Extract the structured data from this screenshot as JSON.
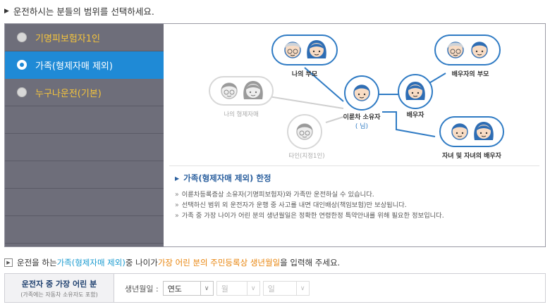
{
  "heading": "운전하시는 분들의 범위를 선택하세요.",
  "options": [
    {
      "label": "기명피보험자1인",
      "selected": false
    },
    {
      "label": "가족(형제자매 제외)",
      "selected": true
    },
    {
      "label": "누구나운전(기본)",
      "selected": false
    }
  ],
  "diagram": {
    "parents": "나의 부모",
    "spouse_parents": "배우자의 부모",
    "siblings": "나의 형제자매",
    "owner_line1": "이륜차 소유자",
    "owner_line2": "(              님)",
    "spouse": "배우자",
    "children": "자녀 및 자녀의 배우자",
    "other": "타인(지정1인)"
  },
  "info": {
    "title": "가족(형제자매 제외) 한정",
    "lines": [
      "이륜차등록증상 소유자(기명피보험자)와 가족만 운전하실 수 있습니다.",
      "선택하신 범위 외 운전자가 운행 중 사고를 내면 대인배상(책임보험)만 보상됩니다.",
      "가족 중 가장 나이가 어린 분의 생년월일은 정확한 연령한정 특약안내를 위해 필요한 정보입니다."
    ]
  },
  "question": {
    "p1": "운전을 하는 ",
    "p2": "가족(형제자매 제외)",
    "p3": " 중 나이가 ",
    "p4": "가장 어린 분의 주민등록상 생년월일",
    "p5": "을 입력해 주세요."
  },
  "form": {
    "label_title": "운전자 중 가장 어린 분",
    "label_sub": "(가족에는 자동차 소유자도 포함)",
    "field_label": "생년월일 :",
    "year": "연도",
    "month": "월",
    "day": "일"
  }
}
